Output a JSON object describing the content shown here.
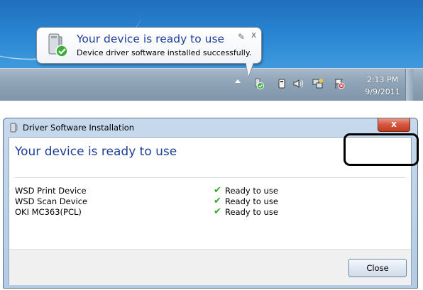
{
  "balloon": {
    "title": "Your device is ready to use",
    "message": "Device driver software installed successfully.",
    "pin_glyph": "✎",
    "close_glyph": "x"
  },
  "taskbar": {
    "clock_time": "2:13 PM",
    "clock_date": "9/9/2011",
    "tray_icons": [
      "show-hidden-arrow-icon",
      "device-installed-icon",
      "removable-device-icon",
      "volume-icon",
      "network-icon",
      "action-center-icon"
    ]
  },
  "dialog": {
    "title": "Driver Software Installation",
    "heading": "Your device is ready to use",
    "close_x": "x",
    "devices": [
      {
        "name": "WSD Print Device",
        "status": "Ready to use"
      },
      {
        "name": "WSD Scan Device",
        "status": "Ready to use"
      },
      {
        "name": "OKI MC363(PCL)",
        "status": "Ready to use"
      }
    ],
    "close_button": "Close"
  }
}
